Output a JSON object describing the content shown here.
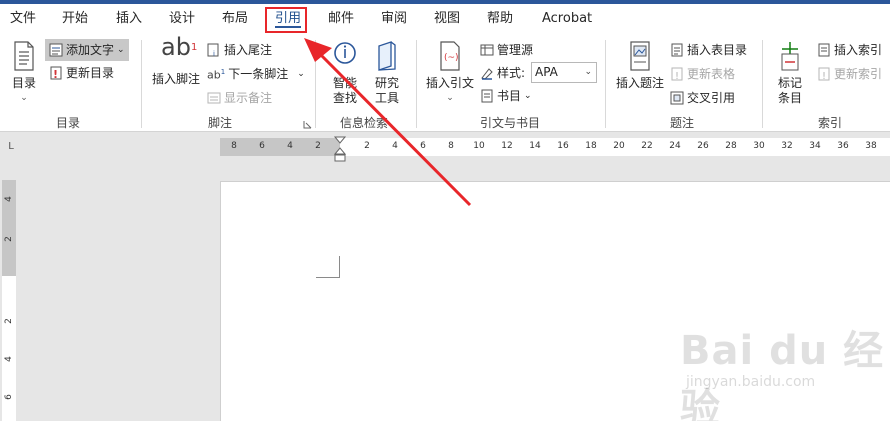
{
  "tabs": [
    {
      "label": "文件"
    },
    {
      "label": "开始"
    },
    {
      "label": "插入"
    },
    {
      "label": "设计"
    },
    {
      "label": "布局"
    },
    {
      "label": "引用"
    },
    {
      "label": "邮件"
    },
    {
      "label": "审阅"
    },
    {
      "label": "视图"
    },
    {
      "label": "帮助"
    },
    {
      "label": "Acrobat"
    }
  ],
  "active_tab": "引用",
  "groups": {
    "toc": {
      "label": "目录",
      "toc_button": "目录",
      "add_text": "添加文字",
      "update_toc": "更新目录"
    },
    "footnotes": {
      "label": "脚注",
      "insert_footnote_line1": "插入脚注",
      "footnote_glyph": "ab",
      "footnote_sup": "1",
      "insert_endnote": "插入尾注",
      "next_footnote": "下一条脚注",
      "show_notes": "显示备注",
      "ab_small": "ab",
      "ab_sup": "1"
    },
    "research": {
      "label": "信息检索",
      "smart_lookup_l1": "智能",
      "smart_lookup_l2": "查找",
      "research_tools_l1": "研究",
      "research_tools_l2": "工具"
    },
    "citations": {
      "label": "引文与书目",
      "insert_citation": "插入引文",
      "manage_sources": "管理源",
      "style_label": "样式:",
      "style_value": "APA",
      "bibliography": "书目"
    },
    "captions": {
      "label": "题注",
      "insert_caption": "插入题注",
      "insert_table_of_figures": "插入表目录",
      "update_table": "更新表格",
      "cross_reference": "交叉引用"
    },
    "index": {
      "label": "索引",
      "mark_entry_l1": "标记",
      "mark_entry_l2": "条目",
      "insert_index": "插入索引",
      "update_index": "更新索引"
    }
  },
  "ruler": {
    "corner": "L",
    "h_left": [
      "8",
      "6",
      "4",
      "2"
    ],
    "h_right": [
      "2",
      "4",
      "6",
      "8",
      "10",
      "12",
      "14",
      "16",
      "18",
      "20",
      "22",
      "24",
      "26",
      "28",
      "30",
      "32",
      "34",
      "36",
      "38"
    ],
    "v_numbers": [
      "4",
      "2",
      "2",
      "4",
      "6"
    ]
  },
  "watermark": {
    "main": "Bai du 经验",
    "sub": "jingyan.baidu.com"
  },
  "colors": {
    "accent": "#2b579a",
    "highlight": "#e8262a",
    "arrow": "#e8262a"
  }
}
